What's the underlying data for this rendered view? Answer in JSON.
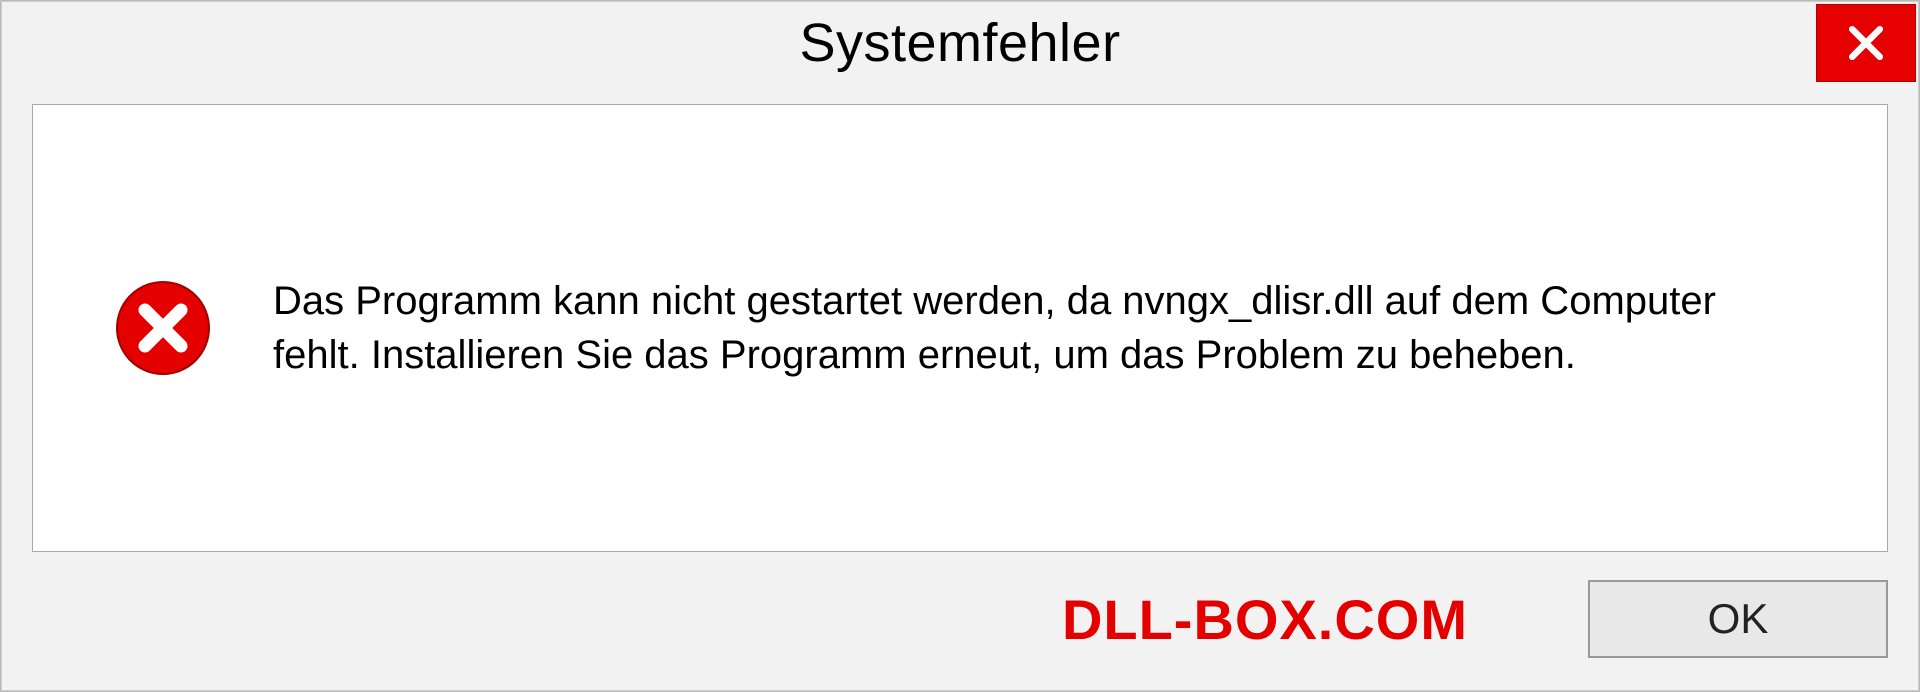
{
  "dialog": {
    "title": "Systemfehler",
    "message": "Das Programm kann nicht gestartet werden, da nvngx_dlisr.dll auf dem Computer fehlt. Installieren Sie das Programm erneut, um das Problem zu beheben.",
    "ok_label": "OK"
  },
  "watermark": "DLL-BOX.COM",
  "colors": {
    "error_red": "#e50000",
    "close_bg": "#e60000"
  }
}
